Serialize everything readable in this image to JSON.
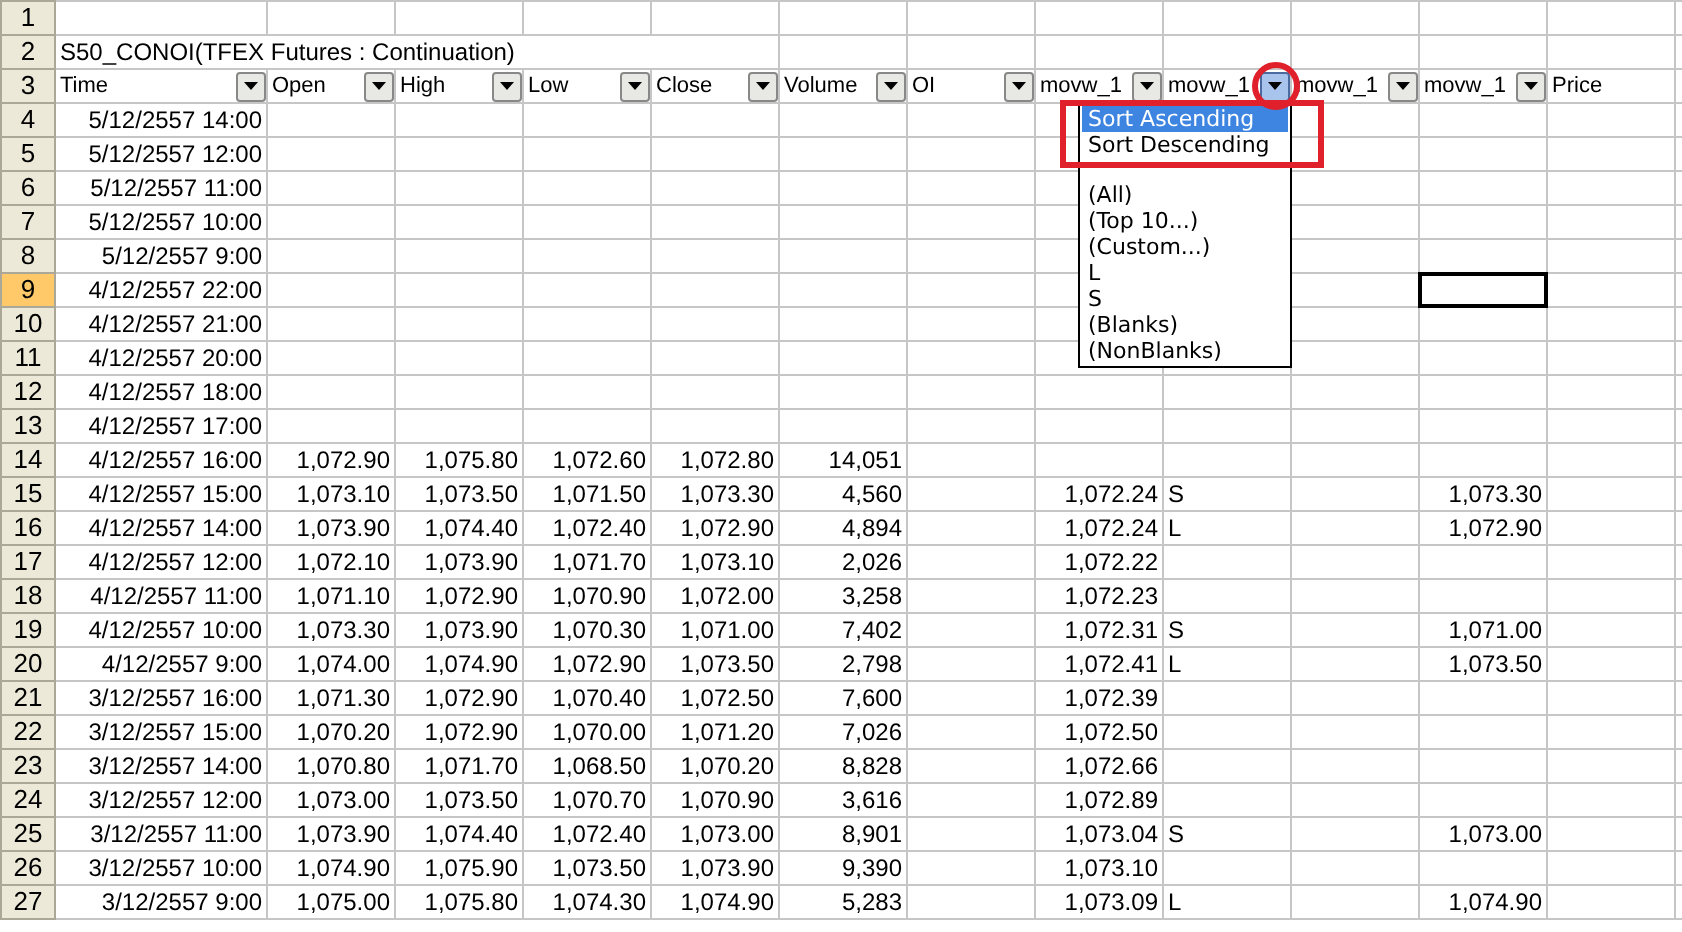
{
  "sheet": {
    "columns": [
      {
        "label": "Time",
        "filter": true,
        "open": false
      },
      {
        "label": "Open",
        "filter": true,
        "open": false
      },
      {
        "label": "High",
        "filter": true,
        "open": false
      },
      {
        "label": "Low",
        "filter": true,
        "open": false
      },
      {
        "label": "Close",
        "filter": true,
        "open": false
      },
      {
        "label": "Volume",
        "filter": true,
        "open": false
      },
      {
        "label": "OI",
        "filter": true,
        "open": false
      },
      {
        "label": "movw_1",
        "filter": true,
        "open": false
      },
      {
        "label": "movw_1",
        "filter": true,
        "open": true
      },
      {
        "label": "movw_1",
        "filter": true,
        "open": false
      },
      {
        "label": "movw_1",
        "filter": true,
        "open": false
      },
      {
        "label": "Price",
        "filter": false,
        "open": false
      }
    ],
    "rows": [
      {
        "number": "1",
        "kind": "blank",
        "selected": false
      },
      {
        "number": "2",
        "kind": "title",
        "selected": false,
        "title": "S50_CONOI(TFEX Futures : Continuation)"
      },
      {
        "number": "3",
        "kind": "header",
        "selected": false
      },
      {
        "number": "4",
        "kind": "data",
        "selected": false,
        "cells": [
          "5/12/2557 14:00"
        ]
      },
      {
        "number": "5",
        "kind": "data",
        "selected": false,
        "cells": [
          "5/12/2557 12:00"
        ]
      },
      {
        "number": "6",
        "kind": "data",
        "selected": false,
        "cells": [
          "5/12/2557 11:00"
        ]
      },
      {
        "number": "7",
        "kind": "data",
        "selected": false,
        "cells": [
          "5/12/2557 10:00"
        ]
      },
      {
        "number": "8",
        "kind": "data",
        "selected": false,
        "cells": [
          "5/12/2557 9:00"
        ]
      },
      {
        "number": "9",
        "kind": "data",
        "selected": true,
        "cells": [
          "4/12/2557 22:00",
          null,
          null,
          null,
          null,
          null,
          null,
          null,
          null,
          null,
          {
            "selected": true
          }
        ]
      },
      {
        "number": "10",
        "kind": "data",
        "selected": false,
        "cells": [
          "4/12/2557 21:00"
        ]
      },
      {
        "number": "11",
        "kind": "data",
        "selected": false,
        "cells": [
          "4/12/2557 20:00"
        ]
      },
      {
        "number": "12",
        "kind": "data",
        "selected": false,
        "cells": [
          "4/12/2557 18:00"
        ]
      },
      {
        "number": "13",
        "kind": "data",
        "selected": false,
        "cells": [
          "4/12/2557 17:00"
        ]
      },
      {
        "number": "14",
        "kind": "data",
        "selected": false,
        "cells": [
          "4/12/2557 16:00",
          "1,072.90",
          "1,075.80",
          "1,072.60",
          "1,072.80",
          "14,051"
        ]
      },
      {
        "number": "15",
        "kind": "data",
        "selected": false,
        "cells": [
          "4/12/2557 15:00",
          "1,073.10",
          "1,073.50",
          "1,071.50",
          "1,073.30",
          "4,560",
          null,
          "1,072.24",
          "S",
          null,
          "1,073.30"
        ]
      },
      {
        "number": "16",
        "kind": "data",
        "selected": false,
        "cells": [
          "4/12/2557 14:00",
          "1,073.90",
          "1,074.40",
          "1,072.40",
          "1,072.90",
          "4,894",
          null,
          "1,072.24",
          "L",
          null,
          "1,072.90"
        ]
      },
      {
        "number": "17",
        "kind": "data",
        "selected": false,
        "cells": [
          "4/12/2557 12:00",
          "1,072.10",
          "1,073.90",
          "1,071.70",
          "1,073.10",
          "2,026",
          null,
          "1,072.22"
        ]
      },
      {
        "number": "18",
        "kind": "data",
        "selected": false,
        "cells": [
          "4/12/2557 11:00",
          "1,071.10",
          "1,072.90",
          "1,070.90",
          "1,072.00",
          "3,258",
          null,
          "1,072.23"
        ]
      },
      {
        "number": "19",
        "kind": "data",
        "selected": false,
        "cells": [
          "4/12/2557 10:00",
          "1,073.30",
          "1,073.90",
          "1,070.30",
          "1,071.00",
          "7,402",
          null,
          "1,072.31",
          "S",
          null,
          "1,071.00"
        ]
      },
      {
        "number": "20",
        "kind": "data",
        "selected": false,
        "cells": [
          "4/12/2557 9:00",
          "1,074.00",
          "1,074.90",
          "1,072.90",
          "1,073.50",
          "2,798",
          null,
          "1,072.41",
          "L",
          null,
          "1,073.50"
        ]
      },
      {
        "number": "21",
        "kind": "data",
        "selected": false,
        "cells": [
          "3/12/2557 16:00",
          "1,071.30",
          "1,072.90",
          "1,070.40",
          "1,072.50",
          "7,600",
          null,
          "1,072.39"
        ]
      },
      {
        "number": "22",
        "kind": "data",
        "selected": false,
        "cells": [
          "3/12/2557 15:00",
          "1,070.20",
          "1,072.90",
          "1,070.00",
          "1,071.20",
          "7,026",
          null,
          "1,072.50"
        ]
      },
      {
        "number": "23",
        "kind": "data",
        "selected": false,
        "cells": [
          "3/12/2557 14:00",
          "1,070.80",
          "1,071.70",
          "1,068.50",
          "1,070.20",
          "8,828",
          null,
          "1,072.66"
        ]
      },
      {
        "number": "24",
        "kind": "data",
        "selected": false,
        "cells": [
          "3/12/2557 12:00",
          "1,073.00",
          "1,073.50",
          "1,070.70",
          "1,070.90",
          "3,616",
          null,
          "1,072.89"
        ]
      },
      {
        "number": "25",
        "kind": "data",
        "selected": false,
        "cells": [
          "3/12/2557 11:00",
          "1,073.90",
          "1,074.40",
          "1,072.40",
          "1,073.00",
          "8,901",
          null,
          "1,073.04",
          "S",
          null,
          "1,073.00"
        ]
      },
      {
        "number": "26",
        "kind": "data",
        "selected": false,
        "cells": [
          "3/12/2557 10:00",
          "1,074.90",
          "1,075.90",
          "1,073.50",
          "1,073.90",
          "9,390",
          null,
          "1,073.10"
        ]
      },
      {
        "number": "27",
        "kind": "data",
        "selected": false,
        "cells": [
          "3/12/2557 9:00",
          "1,075.00",
          "1,075.80",
          "1,074.30",
          "1,074.90",
          "5,283",
          null,
          "1,073.09",
          "L",
          null,
          "1,074.90"
        ]
      }
    ]
  },
  "filter_menu": {
    "items": [
      {
        "kind": "item",
        "label": "Sort Ascending",
        "selected": true
      },
      {
        "kind": "item",
        "label": "Sort Descending",
        "selected": false
      },
      {
        "kind": "separator"
      },
      {
        "kind": "item",
        "label": "(All)",
        "selected": false
      },
      {
        "kind": "item",
        "label": "(Top 10...)",
        "selected": false
      },
      {
        "kind": "item",
        "label": "(Custom...)",
        "selected": false
      },
      {
        "kind": "item",
        "label": "L",
        "selected": false
      },
      {
        "kind": "item",
        "label": "S",
        "selected": false
      },
      {
        "kind": "item",
        "label": "(Blanks)",
        "selected": false
      },
      {
        "kind": "item",
        "label": "(NonBlanks)",
        "selected": false
      }
    ]
  },
  "annotations": [
    {
      "kind": "circle"
    },
    {
      "kind": "rectangle"
    }
  ]
}
